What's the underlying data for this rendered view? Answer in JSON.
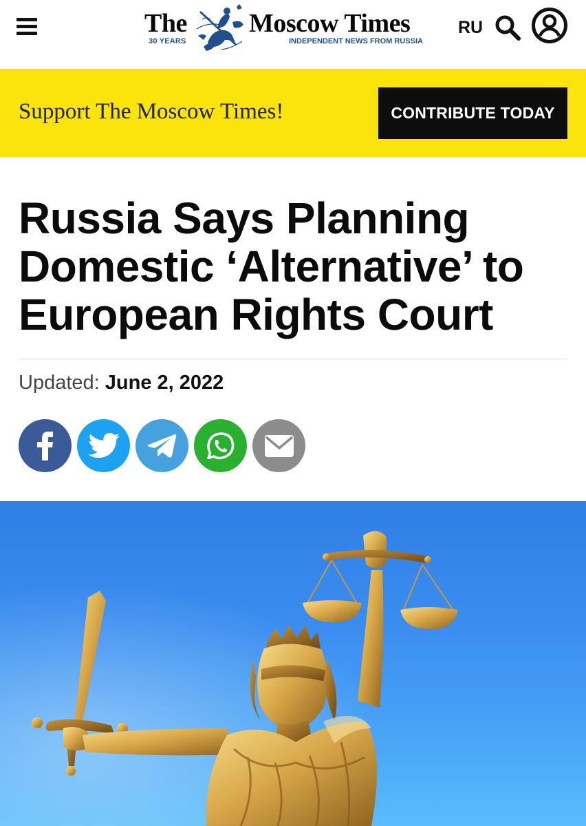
{
  "header": {
    "menu_icon": "hamburger-menu-icon",
    "logo": {
      "the": "The",
      "name": "Moscow Times",
      "years": "30 YEARS",
      "tagline": "INDEPENDENT NEWS FROM RUSSIA"
    },
    "language": "RU",
    "search_icon": "search-icon",
    "account_icon": "account-icon"
  },
  "banner": {
    "text": "Support The Moscow Times!",
    "button_label": "CONTRIBUTE TODAY",
    "background": "#fbe40b"
  },
  "article": {
    "headline": "Russia Says Planning Domestic ‘Alternative’ to European Rights Court",
    "updated_label": "Updated:",
    "updated_date": "June 2, 2022"
  },
  "share": [
    {
      "network": "facebook",
      "icon": "facebook-icon",
      "color": "#3b5a99"
    },
    {
      "network": "twitter",
      "icon": "twitter-icon",
      "color": "#1da1f2"
    },
    {
      "network": "telegram",
      "icon": "telegram-icon",
      "color": "#45a2de"
    },
    {
      "network": "whatsapp",
      "icon": "whatsapp-icon",
      "color": "#29b02e"
    },
    {
      "network": "email",
      "icon": "envelope-icon",
      "color": "#8c8c8c"
    }
  ],
  "hero_image": "lady-justice-statue-photo"
}
